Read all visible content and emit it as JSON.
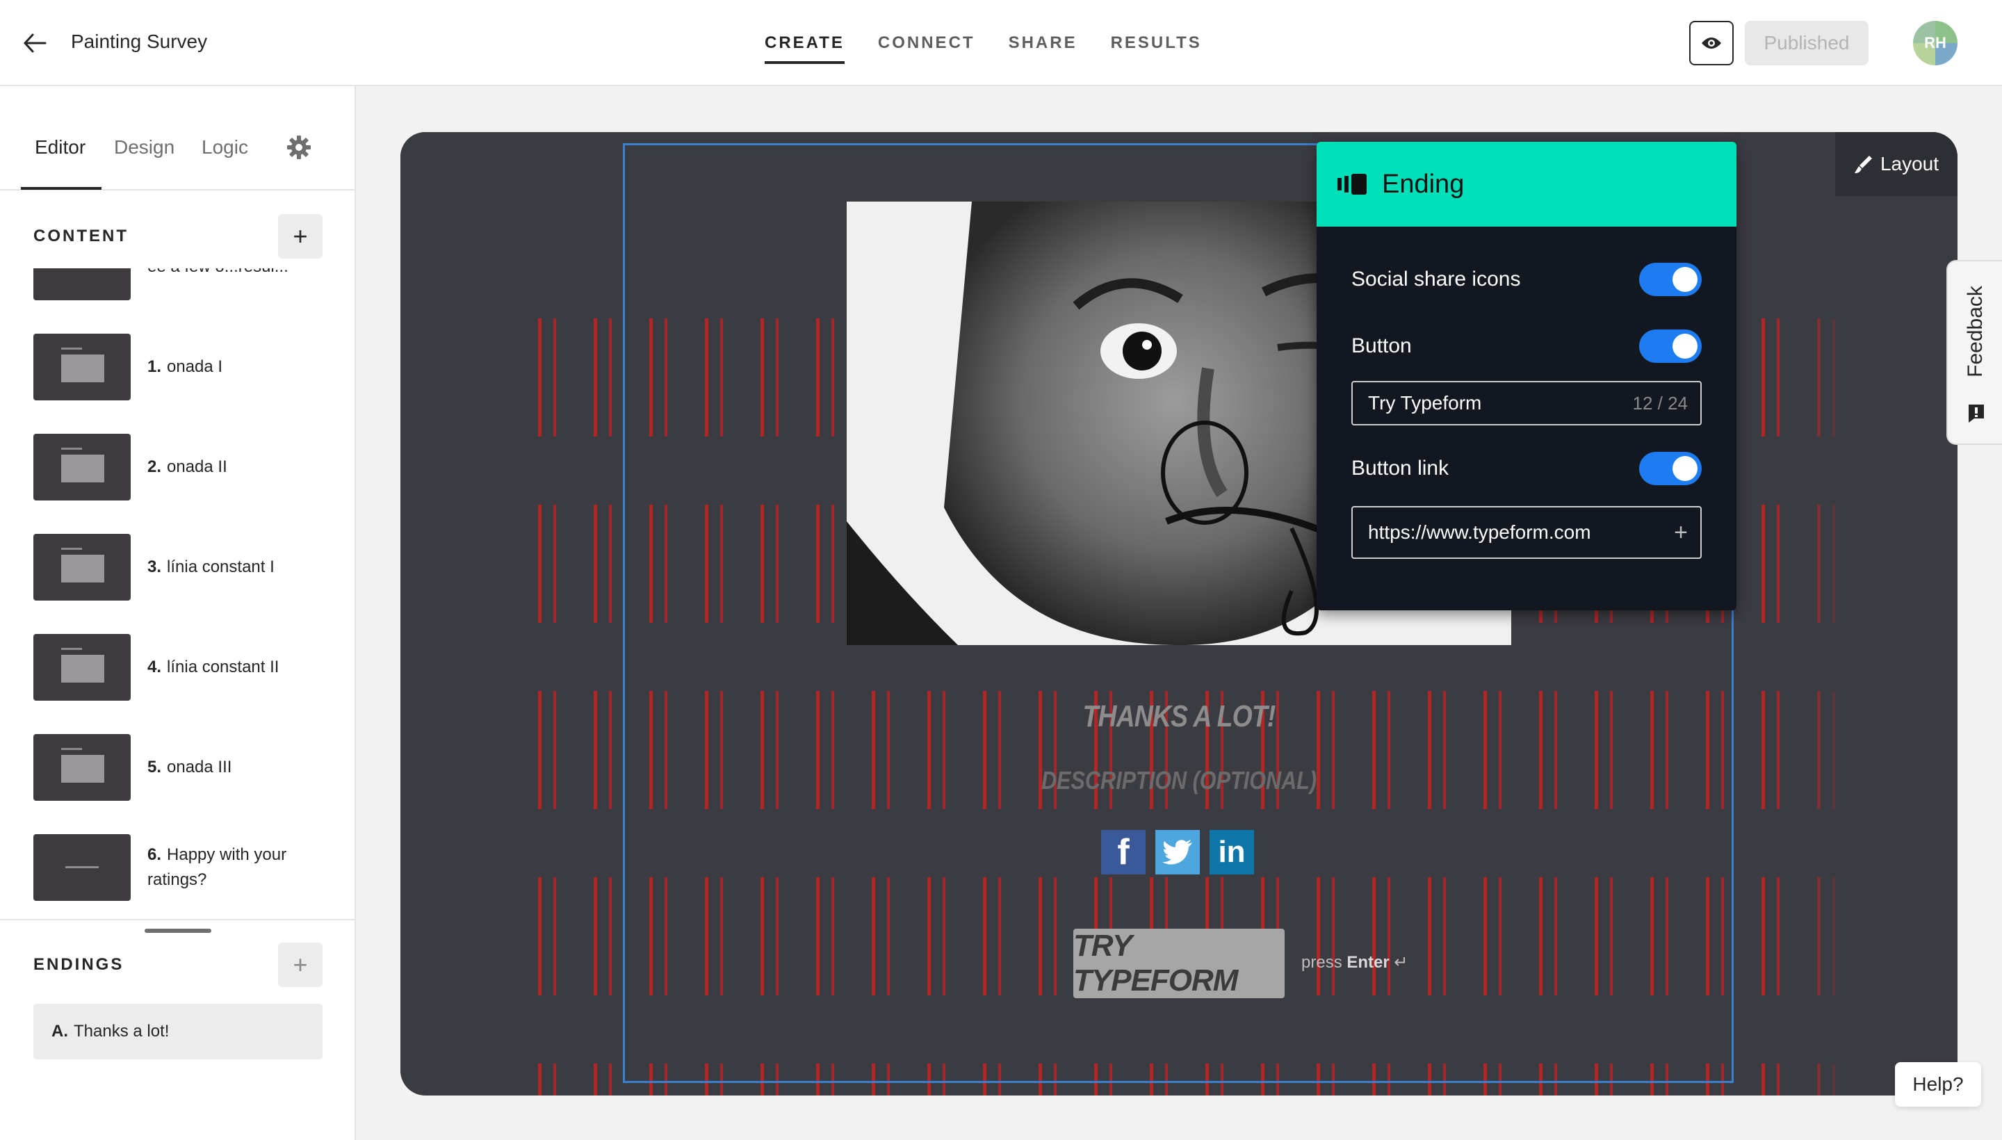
{
  "header": {
    "title": "Painting Survey",
    "tabs": [
      {
        "label": "CREATE",
        "active": true
      },
      {
        "label": "CONNECT",
        "active": false
      },
      {
        "label": "SHARE",
        "active": false
      },
      {
        "label": "RESULTS",
        "active": false
      }
    ],
    "published_label": "Published",
    "avatar_initials": "RH"
  },
  "sidebar": {
    "tabs": [
      {
        "label": "Editor",
        "active": true
      },
      {
        "label": "Design",
        "active": false
      },
      {
        "label": "Logic",
        "active": false
      }
    ],
    "content_label": "CONTENT",
    "questions": [
      {
        "num": "",
        "label": "ee a few o...resul...",
        "thumb": "statement"
      },
      {
        "num": "1.",
        "label": "onada I",
        "thumb": "image"
      },
      {
        "num": "2.",
        "label": "onada II",
        "thumb": "image"
      },
      {
        "num": "3.",
        "label": "línia constant I",
        "thumb": "image"
      },
      {
        "num": "4.",
        "label": "línia constant II",
        "thumb": "image"
      },
      {
        "num": "5.",
        "label": "onada III",
        "thumb": "image"
      },
      {
        "num": "6.",
        "label": "Happy with your ratings?",
        "thumb": "statement"
      }
    ],
    "endings_label": "ENDINGS",
    "endings": [
      {
        "num": "A.",
        "label": "Thanks a lot!"
      }
    ]
  },
  "canvas": {
    "layout_label": "Layout",
    "title": "THANKS A LOT!",
    "description": "DESCRIPTION (OPTIONAL)",
    "share_icons": [
      "facebook-icon",
      "twitter-icon",
      "linkedin-icon"
    ],
    "button_label": "TRY TYPEFORM",
    "press_text": "press",
    "press_key": "Enter",
    "press_glyph": "↵"
  },
  "ending_panel": {
    "title": "Ending",
    "social_share_label": "Social share icons",
    "social_share_on": true,
    "button_label": "Button",
    "button_on": true,
    "button_text_value": "Try Typeform",
    "button_text_count": "12 / 24",
    "button_link_label": "Button link",
    "button_link_on": true,
    "button_link_value": "https://www.typeform.com"
  },
  "feedback_label": "Feedback",
  "help_label": "Help?",
  "colors": {
    "accent_teal": "#00e0b8",
    "toggle_blue": "#1d7cf2",
    "selection_blue": "#3a7fd0",
    "stripe_red": "#dc1e1e"
  }
}
